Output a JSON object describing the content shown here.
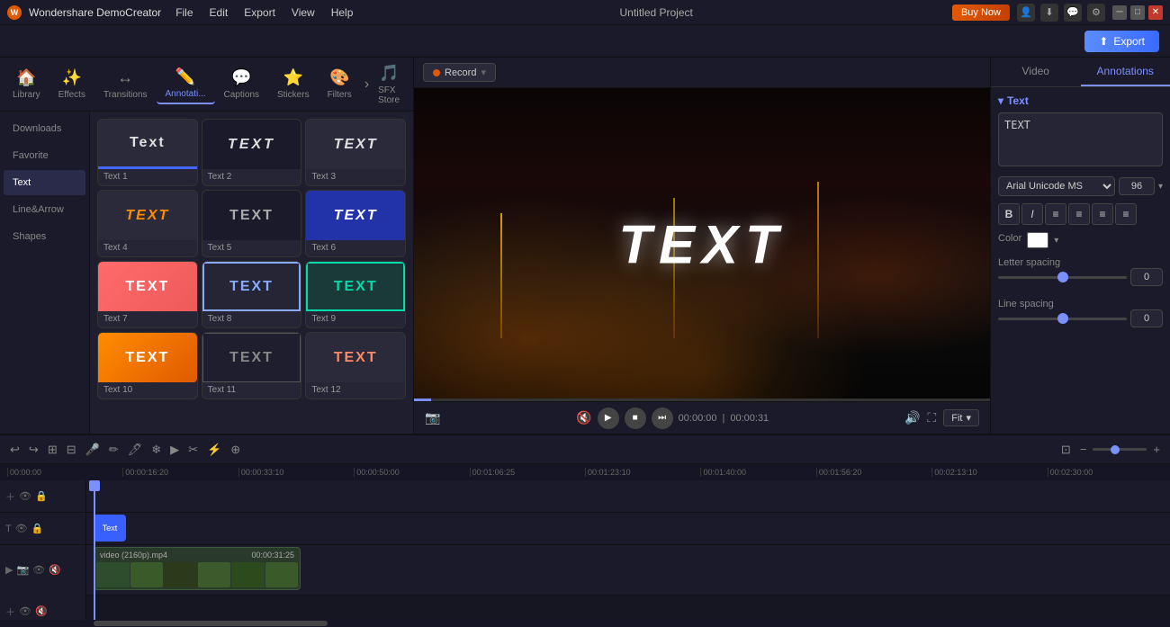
{
  "app": {
    "name": "Wondershare DemoCreator",
    "title": "Untitled Project"
  },
  "menus": {
    "file": "File",
    "edit": "Edit",
    "export": "Export",
    "view": "View",
    "help": "Help"
  },
  "titlebar": {
    "buy_now": "Buy Now",
    "export_btn": "Export"
  },
  "record_bar": {
    "label": "Record"
  },
  "nav_tabs": [
    {
      "id": "library",
      "label": "Library",
      "icon": "🏠"
    },
    {
      "id": "effects",
      "label": "Effects",
      "icon": "✨"
    },
    {
      "id": "transitions",
      "label": "Transitions",
      "icon": "↔"
    },
    {
      "id": "annotations",
      "label": "Annotati...",
      "icon": "✏️",
      "active": true
    },
    {
      "id": "captions",
      "label": "Captions",
      "icon": "💬"
    },
    {
      "id": "stickers",
      "label": "Stickers",
      "icon": "⭐"
    },
    {
      "id": "filters",
      "label": "Filters",
      "icon": "🎨"
    },
    {
      "id": "sfx",
      "label": "SFX Store",
      "icon": "🎵"
    }
  ],
  "sidebar_items": [
    {
      "id": "downloads",
      "label": "Downloads"
    },
    {
      "id": "favorite",
      "label": "Favorite"
    },
    {
      "id": "text",
      "label": "Text",
      "active": true
    },
    {
      "id": "linearrow",
      "label": "Line&Arrow"
    },
    {
      "id": "shapes",
      "label": "Shapes"
    }
  ],
  "text_cards": [
    {
      "id": 1,
      "label": "Text 1",
      "text": "Text",
      "style": "preview-1"
    },
    {
      "id": 2,
      "label": "Text 2",
      "text": "TEXT",
      "style": "preview-2"
    },
    {
      "id": 3,
      "label": "Text 3",
      "text": "TEXT",
      "style": "preview-3"
    },
    {
      "id": 4,
      "label": "Text 4",
      "text": "TEXT",
      "style": "preview-4"
    },
    {
      "id": 5,
      "label": "Text 5",
      "text": "TEXT",
      "style": "preview-5"
    },
    {
      "id": 6,
      "label": "Text 6",
      "text": "TEXT",
      "style": "preview-6"
    },
    {
      "id": 7,
      "label": "Text 7",
      "text": "TEXT",
      "style": "preview-7"
    },
    {
      "id": 8,
      "label": "Text 8",
      "text": "TEXT",
      "style": "preview-8"
    },
    {
      "id": 9,
      "label": "Text 9",
      "text": "TEXT",
      "style": "preview-9"
    },
    {
      "id": 10,
      "label": "Text 10",
      "text": "TEXT",
      "style": "preview-10"
    },
    {
      "id": 11,
      "label": "Text 11",
      "text": "TEXT",
      "style": "preview-11"
    },
    {
      "id": 12,
      "label": "Text 12",
      "text": "TEXT",
      "style": "preview-12"
    }
  ],
  "video_preview": {
    "text_overlay": "TEXT",
    "current_time": "00:00:00",
    "total_time": "00:00:31"
  },
  "right_panel": {
    "tabs": [
      "Video",
      "Annotations"
    ],
    "active_tab": "Annotations",
    "section_title": "Text",
    "text_value": "TEXT",
    "font_family": "Arial Unicode MS",
    "font_size": "96",
    "color_label": "Color",
    "letter_spacing_label": "Letter spacing",
    "letter_spacing_value": "0",
    "line_spacing_label": "Line spacing",
    "line_spacing_value": "0"
  },
  "timeline": {
    "toolbar_icons": [
      "↩",
      "↪",
      "⊞",
      "⊟",
      "🎤",
      "✏",
      "🖊",
      "❄",
      "❄",
      "▶",
      "❌",
      "⚡",
      "⊕"
    ],
    "ruler_marks": [
      "00:00:00",
      "00:00:16:20",
      "00:00:33:10",
      "00:00:50:00",
      "00:01:06:25",
      "00:01:23:10",
      "00:01:40:00",
      "00:01:56:20",
      "00:02:13:10",
      "00:02:30:00"
    ],
    "tracks": [
      {
        "id": "text-track",
        "type": "text",
        "clip_label": "Text"
      },
      {
        "id": "video-track",
        "type": "video",
        "clip_label": "video (2160p).mp4",
        "clip_time": "00:00:31:25"
      },
      {
        "id": "empty-track-1",
        "type": "empty"
      }
    ]
  }
}
